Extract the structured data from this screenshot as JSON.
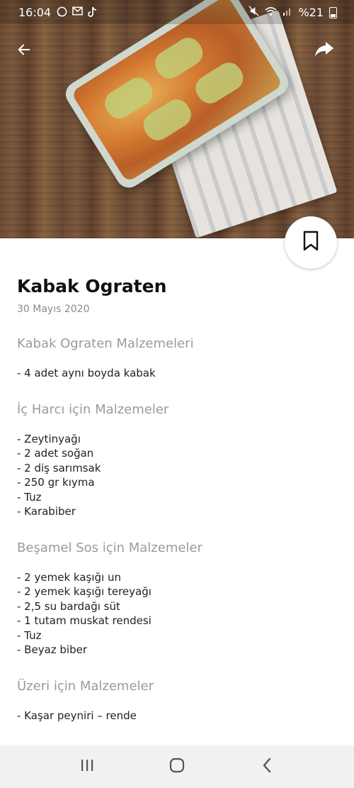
{
  "status_bar": {
    "time": "16:04",
    "battery_text": "%21",
    "left_icons": [
      "whatsapp-icon",
      "gmail-icon",
      "tiktok-icon"
    ],
    "right_icons": [
      "mute-icon",
      "wifi-icon",
      "signal-icon",
      "battery-icon"
    ]
  },
  "header": {
    "back_icon": "arrow-left-icon",
    "share_icon": "share-icon",
    "bookmark_icon": "bookmark-icon"
  },
  "recipe": {
    "title": "Kabak Ograten",
    "date": "30 Mayıs 2020",
    "sections": [
      {
        "heading": "Kabak Ograten Malzemeleri",
        "items": [
          "- 4 adet aynı boyda kabak"
        ]
      },
      {
        "heading": "İç Harcı için Malzemeler",
        "items": [
          "- Zeytinyağı",
          "- 2 adet soğan",
          "- 2 diş sarımsak",
          "- 250 gr kıyma",
          "- Tuz",
          "- Karabiber"
        ]
      },
      {
        "heading": "Beşamel Sos için Malzemeler",
        "items": [
          "- 2 yemek kaşığı un",
          "- 2 yemek kaşığı tereyağı",
          "- 2,5 su bardağı süt",
          "- 1 tutam muskat rendesi",
          "- Tuz",
          "- Beyaz biber"
        ]
      },
      {
        "heading": "Üzeri için Malzemeler",
        "items": [
          "- Kaşar peyniri – rende"
        ]
      }
    ]
  },
  "nav_bar": {
    "icons": [
      "recent-apps-icon",
      "home-icon",
      "back-icon"
    ]
  }
}
